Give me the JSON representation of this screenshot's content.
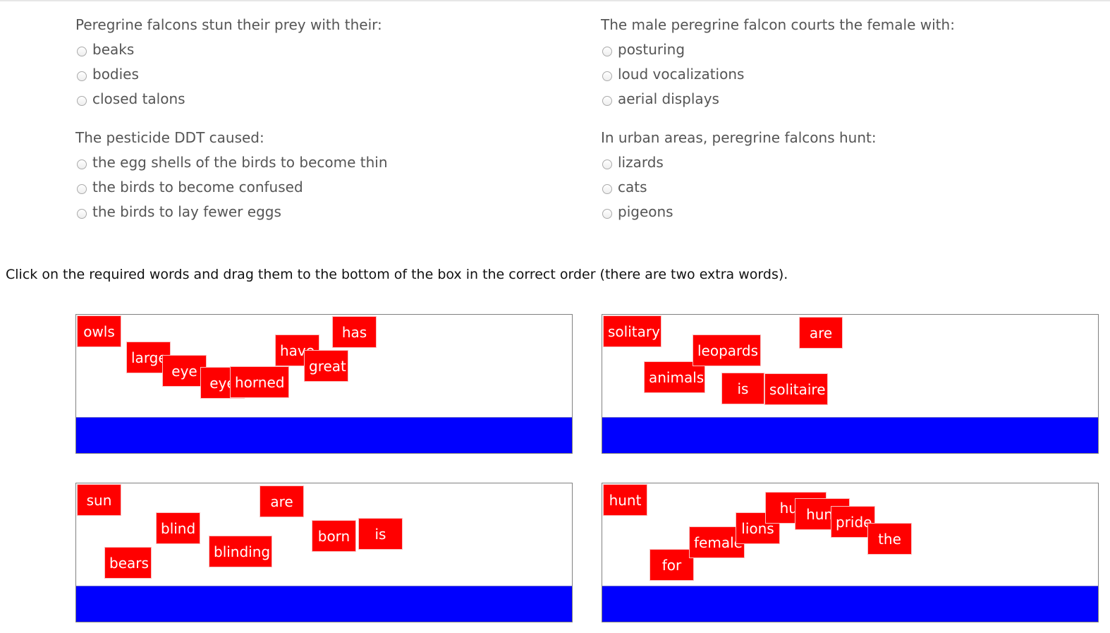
{
  "questions": [
    {
      "text": "Peregrine falcons stun their prey with their:",
      "options": [
        "beaks",
        "bodies",
        "closed talons"
      ]
    },
    {
      "text": "The male peregrine falcon courts the female with:",
      "options": [
        "posturing",
        "loud vocalizations",
        "aerial displays"
      ]
    },
    {
      "text": "The pesticide DDT caused:",
      "options": [
        "the egg shells of the birds to become thin",
        "the birds to become confused",
        "the birds to lay fewer eggs"
      ]
    },
    {
      "text": "In urban areas, peregrine falcons hunt:",
      "options": [
        "lizards",
        "cats",
        "pigeons"
      ]
    }
  ],
  "instructions": "Click on the required words and drag them to the bottom of the box in the correct order (there are two extra words).",
  "colors": {
    "tile": "#ff0000",
    "drop_zone": "#0000ff"
  },
  "puzzles": [
    {
      "words": [
        "owls",
        "large",
        "eye",
        "eye",
        "horned",
        "have",
        "great",
        "has"
      ]
    },
    {
      "words": [
        "solitary",
        "animals",
        "leopards",
        "is",
        "solitaire",
        "are"
      ]
    },
    {
      "words": [
        "sun",
        "bears",
        "blind",
        "blinding",
        "are",
        "born",
        "is"
      ]
    },
    {
      "words": [
        "hunt",
        "for",
        "female",
        "lions",
        "hunt",
        "hunt",
        "pride",
        "the"
      ]
    }
  ]
}
